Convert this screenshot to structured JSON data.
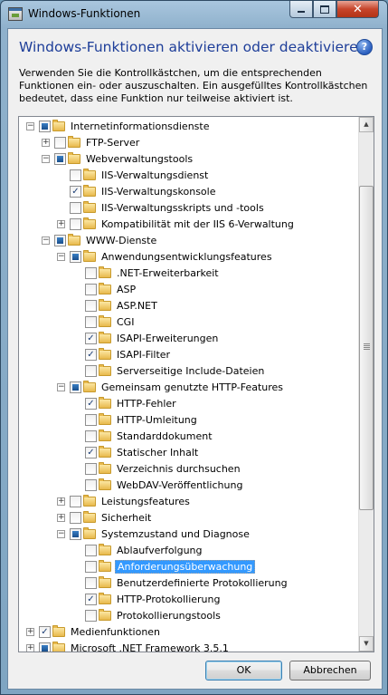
{
  "window": {
    "title": "Windows-Funktionen",
    "min_label": "",
    "max_label": "",
    "close_label": "✕"
  },
  "dialog": {
    "heading": "Windows-Funktionen aktivieren oder deaktivieren",
    "help_label": "?",
    "description": "Verwenden Sie die Kontrollkästchen, um die entsprechenden Funktionen ein- oder auszuschalten. Ein ausgefülltes Kontrollkästchen bedeutet, dass eine Funktion nur teilweise aktiviert ist."
  },
  "tree": [
    {
      "label": "Internetinformationsdienste",
      "level": 0,
      "expander": "minus",
      "check": "partial"
    },
    {
      "label": "FTP-Server",
      "level": 1,
      "expander": "plus",
      "check": "none"
    },
    {
      "label": "Webverwaltungstools",
      "level": 1,
      "expander": "minus",
      "check": "partial"
    },
    {
      "label": "IIS-Verwaltungsdienst",
      "level": 2,
      "expander": "",
      "check": "none"
    },
    {
      "label": "IIS-Verwaltungskonsole",
      "level": 2,
      "expander": "",
      "check": "checked"
    },
    {
      "label": "IIS-Verwaltungsskripts und -tools",
      "level": 2,
      "expander": "",
      "check": "none"
    },
    {
      "label": "Kompatibilität mit der IIS 6-Verwaltung",
      "level": 2,
      "expander": "plus",
      "check": "none"
    },
    {
      "label": "WWW-Dienste",
      "level": 1,
      "expander": "minus",
      "check": "partial"
    },
    {
      "label": "Anwendungsentwicklungsfeatures",
      "level": 2,
      "expander": "minus",
      "check": "partial"
    },
    {
      "label": ".NET-Erweiterbarkeit",
      "level": 3,
      "expander": "",
      "check": "none"
    },
    {
      "label": "ASP",
      "level": 3,
      "expander": "",
      "check": "none"
    },
    {
      "label": "ASP.NET",
      "level": 3,
      "expander": "",
      "check": "none"
    },
    {
      "label": "CGI",
      "level": 3,
      "expander": "",
      "check": "none"
    },
    {
      "label": "ISAPI-Erweiterungen",
      "level": 3,
      "expander": "",
      "check": "checked"
    },
    {
      "label": "ISAPI-Filter",
      "level": 3,
      "expander": "",
      "check": "checked"
    },
    {
      "label": "Serverseitige Include-Dateien",
      "level": 3,
      "expander": "",
      "check": "none"
    },
    {
      "label": "Gemeinsam genutzte HTTP-Features",
      "level": 2,
      "expander": "minus",
      "check": "partial"
    },
    {
      "label": "HTTP-Fehler",
      "level": 3,
      "expander": "",
      "check": "checked"
    },
    {
      "label": "HTTP-Umleitung",
      "level": 3,
      "expander": "",
      "check": "none"
    },
    {
      "label": "Standarddokument",
      "level": 3,
      "expander": "",
      "check": "none"
    },
    {
      "label": "Statischer Inhalt",
      "level": 3,
      "expander": "",
      "check": "checked"
    },
    {
      "label": "Verzeichnis durchsuchen",
      "level": 3,
      "expander": "",
      "check": "none"
    },
    {
      "label": "WebDAV-Veröffentlichung",
      "level": 3,
      "expander": "",
      "check": "none"
    },
    {
      "label": "Leistungsfeatures",
      "level": 2,
      "expander": "plus",
      "check": "none"
    },
    {
      "label": "Sicherheit",
      "level": 2,
      "expander": "plus",
      "check": "none"
    },
    {
      "label": "Systemzustand und Diagnose",
      "level": 2,
      "expander": "minus",
      "check": "partial"
    },
    {
      "label": "Ablaufverfolgung",
      "level": 3,
      "expander": "",
      "check": "none"
    },
    {
      "label": "Anforderungsüberwachung",
      "level": 3,
      "expander": "",
      "check": "none",
      "selected": true
    },
    {
      "label": "Benutzerdefinierte Protokollierung",
      "level": 3,
      "expander": "",
      "check": "none"
    },
    {
      "label": "HTTP-Protokollierung",
      "level": 3,
      "expander": "",
      "check": "checked"
    },
    {
      "label": "Protokollierungstools",
      "level": 3,
      "expander": "",
      "check": "none"
    },
    {
      "label": "Medienfunktionen",
      "level": 0,
      "expander": "plus",
      "check": "checked"
    },
    {
      "label": "Microsoft .NET Framework 3.5.1",
      "level": 0,
      "expander": "plus",
      "check": "partial"
    }
  ],
  "buttons": {
    "ok": "OK",
    "cancel": "Abbrechen"
  },
  "scrollbar": {
    "up_label": "▲",
    "down_label": "▼"
  },
  "colors": {
    "heading": "#1e3e99",
    "selection": "#3399ff",
    "close_button": "#c7452b"
  }
}
